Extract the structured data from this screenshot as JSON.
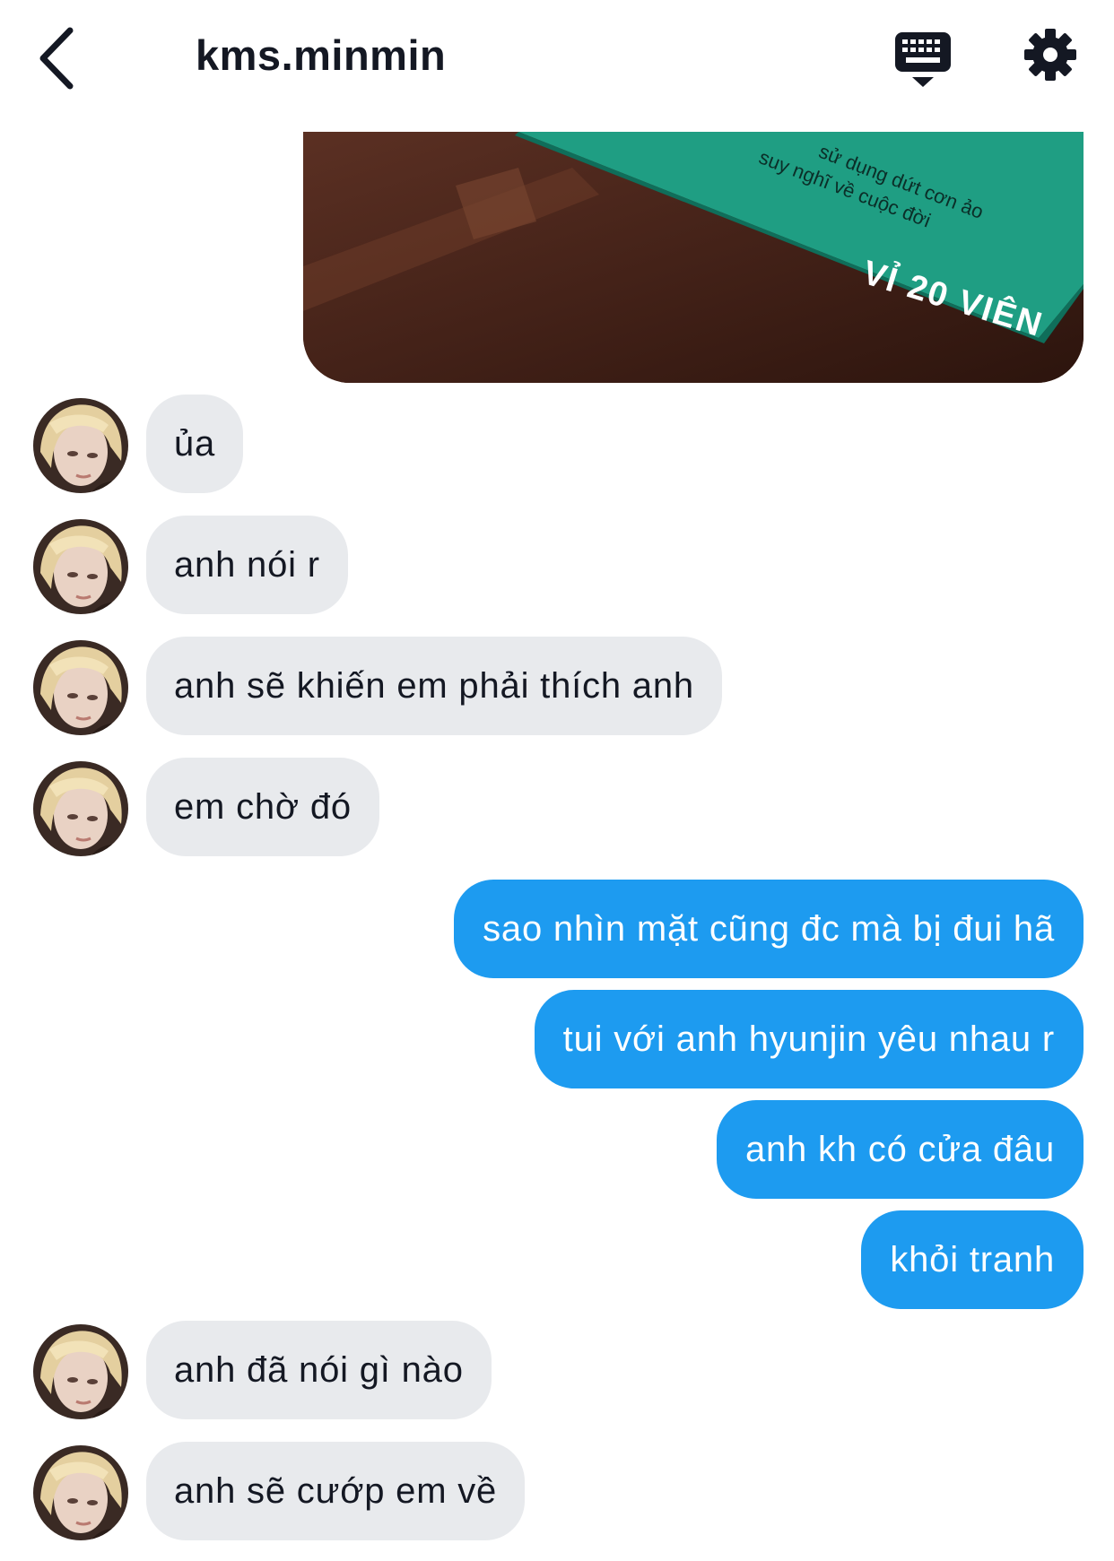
{
  "header": {
    "title": "kms.minmin",
    "back_icon": "chevron-left-icon",
    "keyboard_icon": "keyboard-icon",
    "settings_icon": "gear-icon"
  },
  "photo_attachment": {
    "printed_text": [
      "sử dụng dứt cơn ảo",
      "suy nghĩ về cuộc đời",
      "VỈ 20 VIÊN"
    ]
  },
  "colors": {
    "outgoing_bubble": "#1d9bf0",
    "incoming_bubble": "#e8eaed",
    "text": "#141823"
  },
  "messages": [
    {
      "from": "them",
      "text": "ủa"
    },
    {
      "from": "them",
      "text": "anh nói r"
    },
    {
      "from": "them",
      "text": "anh sẽ khiến em phải thích anh"
    },
    {
      "from": "them",
      "text": "em chờ đó"
    },
    {
      "from": "me",
      "text": "sao nhìn mặt cũng đc mà bị đui hã"
    },
    {
      "from": "me",
      "text": "tui với anh hyunjin yêu nhau r"
    },
    {
      "from": "me",
      "text": "anh kh có cửa đâu"
    },
    {
      "from": "me",
      "text": "khỏi tranh"
    },
    {
      "from": "them",
      "text": "anh đã nói gì nào"
    },
    {
      "from": "them",
      "text": "anh sẽ cướp em về"
    }
  ]
}
